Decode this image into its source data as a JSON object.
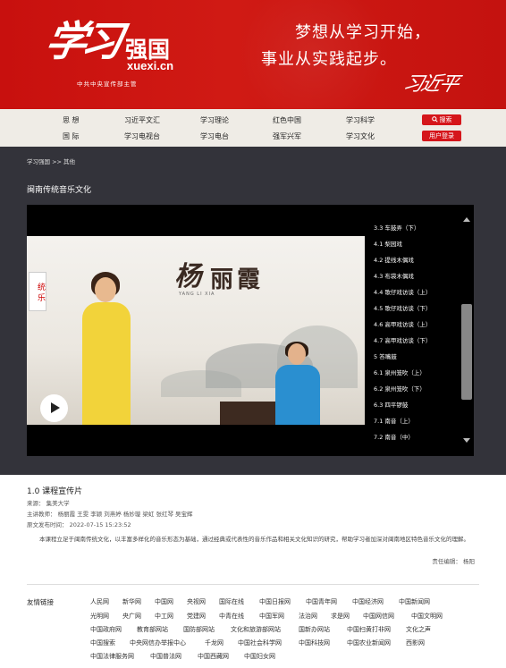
{
  "header": {
    "logo_calligraphy": "学习",
    "logo_name": "强国",
    "logo_domain": "xuexi.cn",
    "logo_sub": "中共中央宣传部主管",
    "slogan_line1": "梦想从学习开始，",
    "slogan_line2": "事业从实践起步。",
    "signature": "习近平"
  },
  "nav": {
    "rows": [
      [
        "思 想",
        "习近平文汇",
        "学习理论",
        "红色中国",
        "学习科学"
      ],
      [
        "国 际",
        "学习电视台",
        "学习电台",
        "强军兴军",
        "学习文化"
      ]
    ],
    "search_button": "搜索",
    "login_button": "用户登录"
  },
  "breadcrumb": "学习强国 >> 其他",
  "course_title": "闽南传统音乐文化",
  "video": {
    "calligraphy_surname": "杨",
    "calligraphy_name": "丽霞",
    "romanized": "YANG LI XIA",
    "side_scroll_text": "统 乐"
  },
  "chapters": [
    "3.3 车鼓弄（下）",
    "4.1 梨园戏",
    "4.2 提线木偶戏",
    "4.3 布袋木偶戏",
    "4.4 歌仔戏访谈（上）",
    "4.5 歌仔戏访谈（下）",
    "4.6 高甲戏访谈（上）",
    "4.7 高甲戏访谈（下）",
    "5 答嘴鼓",
    "6.1 泉州笼吹（上）",
    "6.2 泉州笼吹（下）",
    "6.3 四平锣鼓",
    "7.1 南音（上）",
    "7.2 南音（中）"
  ],
  "lesson": {
    "title": "1.0 课程宣传片",
    "source": "来源：  集美大学",
    "teachers": "主讲教师：  杨丽霞 王雯 李颖 刘燕婷 杨妙璇 梁虹 张红琴 吴宝辉",
    "publish_time": "原文发布时间：  2022-07-15 15:23:52",
    "description": "本课程立足于闽南传统文化，以丰富多样化的音乐形态为基础，通过经典或代表性的音乐作品和相关文化知识的研究，帮助学习者加深对闽南地区特色音乐文化的理解。",
    "editor": "责任编辑：  杨阳"
  },
  "friend_links": {
    "label": "友情链接",
    "rows": [
      [
        "人民网",
        "新华网",
        "中国网",
        "央视网",
        "国际在线",
        "中国日报网",
        "中国青年网",
        "中国经济网",
        "中国新闻网"
      ],
      [
        "光明网",
        "央广网",
        "中工网",
        "党建网",
        "中青在线",
        "中国军网",
        "法治网",
        "求是网",
        "中国网信网",
        "中国文明网"
      ],
      [
        "中国政府网",
        "教育部网站",
        "国防部网站",
        "文化和旅游部网站",
        "国新办网站",
        "中国扫黄打非网",
        "文化之声"
      ],
      [
        "中国搜索",
        "中央网信办举报中心",
        "千龙网",
        "中国社会科学网",
        "中国科技网",
        "中国农业新闻网",
        "西影网"
      ],
      [
        "中国法律服务网",
        "中国普法网",
        "中国西藏网",
        "中国妇女网"
      ]
    ]
  }
}
